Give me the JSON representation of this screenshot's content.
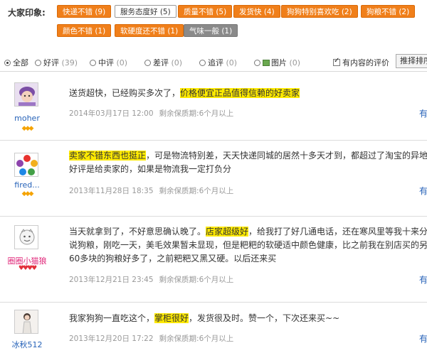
{
  "impressions": {
    "label": "大家印象:",
    "tags": [
      {
        "label": "快递不错 (9)",
        "state": "normal"
      },
      {
        "label": "服务态度好 (5)",
        "state": "selected"
      },
      {
        "label": "质量不错 (5)",
        "state": "normal"
      },
      {
        "label": "发货快 (4)",
        "state": "normal"
      },
      {
        "label": "狗狗特别喜欢吃 (2)",
        "state": "normal"
      },
      {
        "label": "狗粮不错 (2)",
        "state": "normal"
      },
      {
        "label": "颜色不错 (1)",
        "state": "normal"
      },
      {
        "label": "软硬度还不错 (1)",
        "state": "normal"
      },
      {
        "label": "气味一般 (1)",
        "state": "gray"
      }
    ]
  },
  "filters": {
    "all": "全部",
    "good": "好评",
    "good_count": "(39)",
    "medium": "中评",
    "medium_count": "(0)",
    "bad": "差评",
    "bad_count": "(0)",
    "append": "追评",
    "append_count": "(0)",
    "image": "图片",
    "image_count": "(0)",
    "with_content": "有内容的评价",
    "sort": "推择排序"
  },
  "reviews": [
    {
      "user": "moher",
      "text": [
        "送货超快，已经购买多次了，",
        "价格便宜正品值得信赖的好卖家",
        ""
      ],
      "date": "2014年03月17日 12:00",
      "keep": "剩余保质期:6个月以上",
      "useful": "有"
    },
    {
      "user": "fired...",
      "text": [
        "",
        "卖家不错东西也挺正",
        "，可是物流特别差，天天快递同城的居然十多天才到，都超过了淘宝的异地"
      ],
      "text2": "好评是给卖家的，如果是物流我一定打负分",
      "date": "2013年11月28日 18:35",
      "keep": "剩余保质期:6个月以上",
      "useful": "有"
    },
    {
      "user": "圈圈小猫狼",
      "text": [
        "当天就拿到了，不好意思确认晚了。",
        "店家超级好",
        "，给我打了好几通电话，还在寒风里等我十来分"
      ],
      "text2": "说狗粮，刚吃一天，美毛效果暂未显现，但是粑粑的软硬适中颜色健康，比之前我在别店买的另",
      "text3": "60多块的狗粮好多了，之前粑粑又黑又硬。以后还来买",
      "date": "2013年12月21日 23:45",
      "keep": "剩余保质期:6个月以上",
      "useful": "有"
    },
    {
      "user": "冰秋512",
      "text": [
        "我家狗狗一直吃这个，",
        "掌柜很好",
        "，发货很及时。赞一个，下次还来买~~"
      ],
      "date": "2013年12月20日 17:22",
      "keep": "剩余保质期:6个月以上",
      "useful": "有"
    }
  ],
  "colors": {
    "tag": "#f07f1a",
    "highlight": "#ffea00",
    "link": "#2662b8"
  }
}
